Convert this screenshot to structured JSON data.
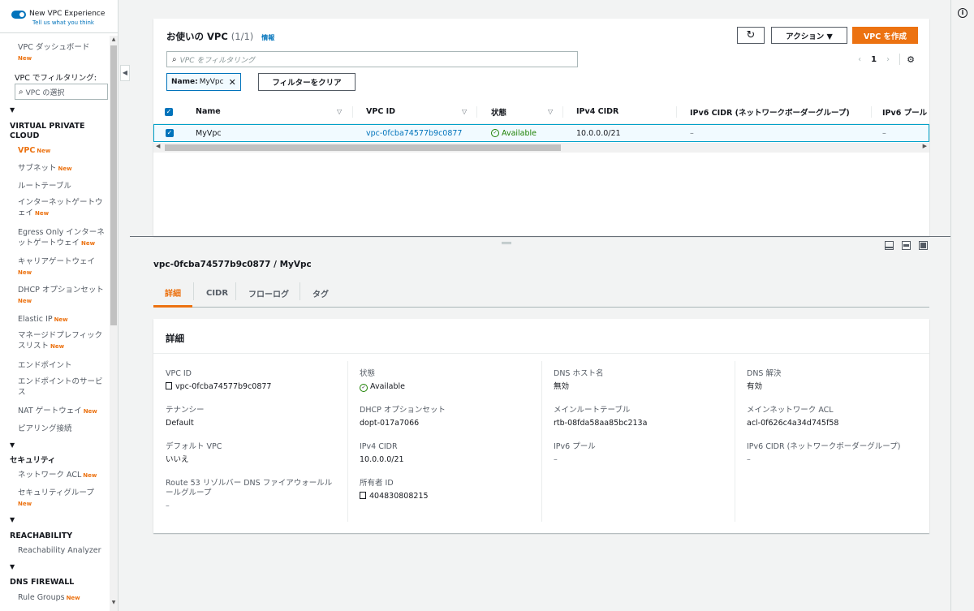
{
  "sidebar": {
    "toggle_title": "New VPC Experience",
    "toggle_sub": "Tell us what you think",
    "dashboard": "VPC ダッシュボード",
    "new": "New",
    "filter_label": "VPC でフィルタリング:",
    "filter_placeholder": "VPC の選択",
    "section_vpc": "VIRTUAL PRIVATE CLOUD",
    "items_vpc": [
      "VPC",
      "サブネット",
      "ルートテーブル",
      "インターネットゲートウェイ",
      "Egress Only インターネットゲートウェイ",
      "キャリアゲートウェイ",
      "DHCP オプションセット",
      "Elastic IP",
      "マネージドプレフィックスリスト",
      "エンドポイント",
      "エンドポイントのサービス",
      "NAT ゲートウェイ",
      "ピアリング接続"
    ],
    "section_security": "セキュリティ",
    "items_security": [
      "ネットワーク ACL",
      "セキュリティグループ"
    ],
    "section_reach": "REACHABILITY",
    "items_reach": [
      "Reachability Analyzer"
    ],
    "section_dns": "DNS FIREWALL",
    "items_dns": [
      "Rule Groups"
    ]
  },
  "vpc_list": {
    "title": "お使いの VPC",
    "count": "(1/1)",
    "info": "情報",
    "refresh_icon": "refresh-icon",
    "actions_label": "アクション ▼",
    "create_label": "VPC を作成",
    "search_placeholder": "VPC をフィルタリング",
    "page": "1",
    "chip_key": "Name:",
    "chip_value": "MyVpc",
    "clear_filters": "フィルターをクリア",
    "columns": [
      "Name",
      "VPC ID",
      "状態",
      "IPv4 CIDR",
      "IPv6 CIDR (ネットワークボーダーグループ)",
      "IPv6 プール"
    ],
    "row": {
      "name": "MyVpc",
      "vpc_id": "vpc-0fcba74577b9c0877",
      "state": "Available",
      "ipv4": "10.0.0.0/21",
      "ipv6": "–",
      "ipv6pool": "–"
    }
  },
  "detail": {
    "title": "vpc-0fcba74577b9c0877 / MyVpc",
    "tabs": [
      "詳細",
      "CIDR",
      "フローログ",
      "タグ"
    ],
    "panel_title": "詳細",
    "fields": {
      "vpc_id": {
        "k": "VPC ID",
        "v": "vpc-0fcba74577b9c0877"
      },
      "tenancy": {
        "k": "テナンシー",
        "v": "Default"
      },
      "default_vpc": {
        "k": "デフォルト VPC",
        "v": "いいえ"
      },
      "route53": {
        "k": "Route 53 リゾルバー DNS ファイアウォールルールグループ",
        "v": "–"
      },
      "state": {
        "k": "状態",
        "v": "Available"
      },
      "dhcp": {
        "k": "DHCP オプションセット",
        "v": "dopt-017a7066"
      },
      "ipv4": {
        "k": "IPv4 CIDR",
        "v": "10.0.0.0/21"
      },
      "owner": {
        "k": "所有者 ID",
        "v": "404830808215"
      },
      "dns_host": {
        "k": "DNS ホスト名",
        "v": "無効"
      },
      "main_rt": {
        "k": "メインルートテーブル",
        "v": "rtb-08fda58aa85bc213a"
      },
      "ipv6_pool": {
        "k": "IPv6 プール",
        "v": "–"
      },
      "dns_res": {
        "k": "DNS 解決",
        "v": "有効"
      },
      "main_acl": {
        "k": "メインネットワーク ACL",
        "v": "acl-0f626c4a34d745f58"
      },
      "ipv6_cidr": {
        "k": "IPv6 CIDR (ネットワークボーダーグループ)",
        "v": "–"
      }
    }
  }
}
